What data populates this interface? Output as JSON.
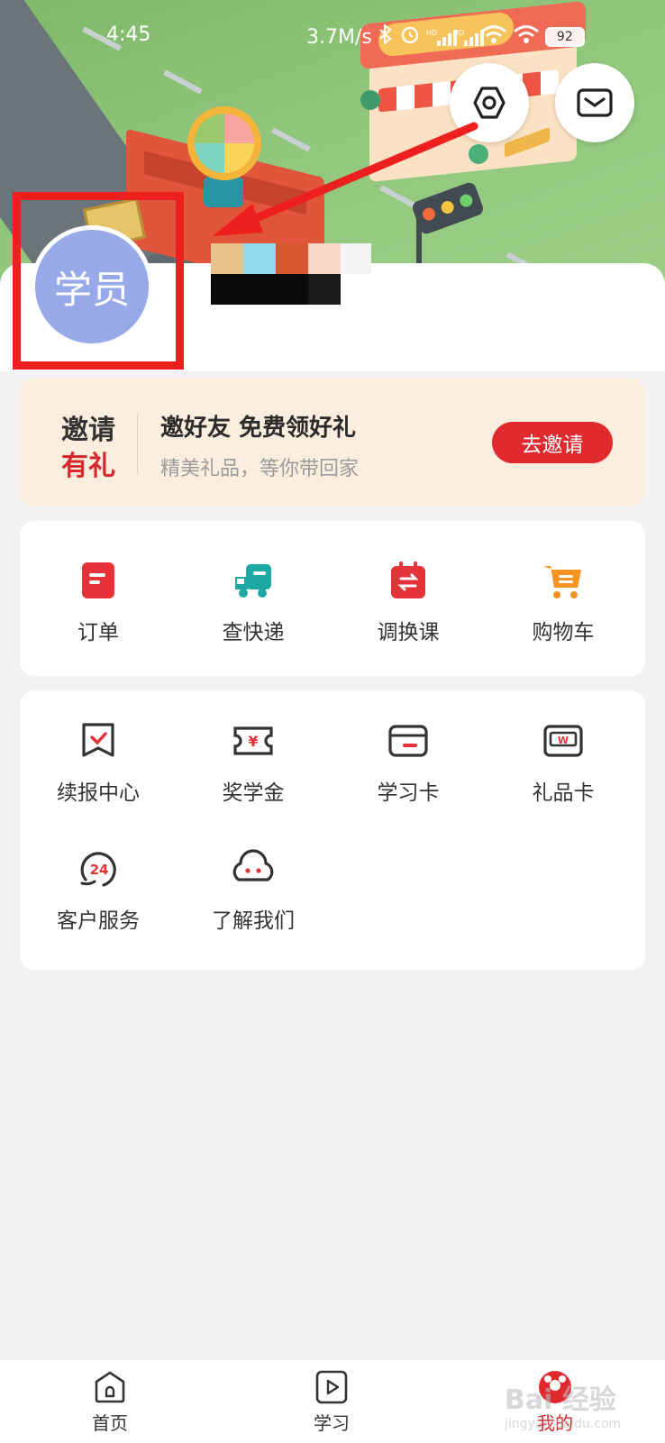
{
  "status_bar": {
    "time": "4:45",
    "speed": "3.7M/s",
    "battery": "92"
  },
  "header": {
    "settings_icon": "hexagon-settings-icon",
    "message_icon": "envelope-icon"
  },
  "profile": {
    "avatar_text": "学员"
  },
  "invite": {
    "tag_line1": "邀请",
    "tag_line2": "有礼",
    "title": "邀好友 免费领好礼",
    "subtitle": "精美礼品，等你带回家",
    "button": "去邀请"
  },
  "quick_actions": [
    {
      "label": "订单",
      "icon": "order-icon"
    },
    {
      "label": "查快递",
      "icon": "delivery-truck-icon"
    },
    {
      "label": "调换课",
      "icon": "swap-course-icon"
    },
    {
      "label": "购物车",
      "icon": "shopping-cart-icon"
    }
  ],
  "services": [
    {
      "label": "续报中心",
      "icon": "renew-icon"
    },
    {
      "label": "奖学金",
      "icon": "scholarship-icon"
    },
    {
      "label": "学习卡",
      "icon": "study-card-icon"
    },
    {
      "label": "礼品卡",
      "icon": "gift-card-icon"
    },
    {
      "label": "客户服务",
      "icon": "customer-service-24-icon"
    },
    {
      "label": "了解我们",
      "icon": "about-us-icon"
    }
  ],
  "bottom_nav": [
    {
      "label": "首页",
      "icon": "home-icon",
      "active": false
    },
    {
      "label": "学习",
      "icon": "play-icon",
      "active": false
    },
    {
      "label": "我的",
      "icon": "profile-icon",
      "active": true
    }
  ],
  "watermark": {
    "text": "Bai 经验",
    "sub": "jingyan.baidu.com"
  },
  "colors": {
    "accent": "#e02a30",
    "invite_bg": "#fbeede",
    "avatar_bg": "#98a9e9"
  }
}
